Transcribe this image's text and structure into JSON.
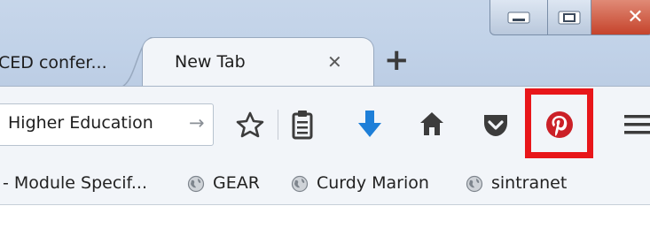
{
  "tabs": [
    {
      "label": "CED confer...",
      "active": false
    },
    {
      "label": "New Tab",
      "active": true
    }
  ],
  "tab_close_symbol": "✕",
  "new_tab_symbol": "+",
  "url_bar": {
    "value": "Higher Education",
    "go_symbol": "→"
  },
  "toolbar_icons": [
    "star-icon",
    "reading-list-icon",
    "download-arrow-icon",
    "home-icon",
    "pocket-icon",
    "pinterest-icon",
    "hamburger-menu-icon"
  ],
  "bookmarks": [
    {
      "label": "- Module Specif...",
      "icon": null
    },
    {
      "label": "GEAR",
      "icon": "globe-icon"
    },
    {
      "label": "Curdy Marion",
      "icon": "globe-icon"
    },
    {
      "label": "sintranet",
      "icon": "globe-icon"
    }
  ],
  "colors": {
    "pinterest": "#cb2027",
    "highlight": "#e8161a",
    "download": "#1e7fd8",
    "toolbar_icon": "#3c3c3c",
    "close_button": "#c5432b"
  }
}
